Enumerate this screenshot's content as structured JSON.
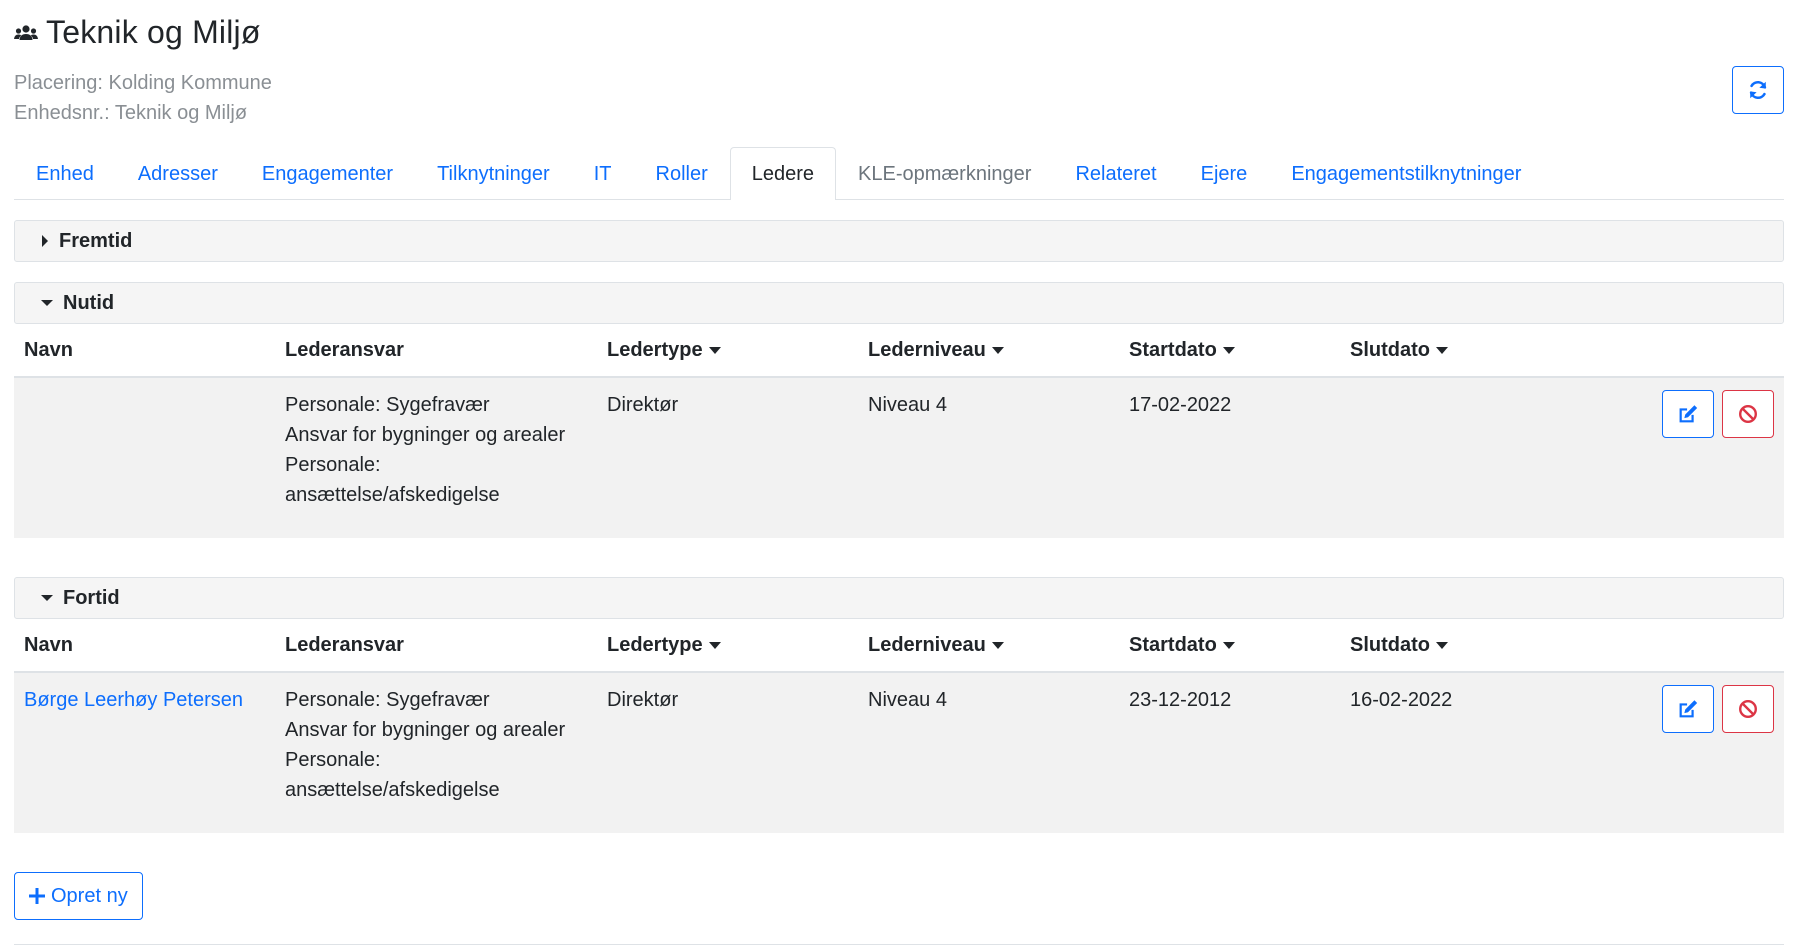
{
  "header": {
    "title": "Teknik og Miljø",
    "placering": "Placering: Kolding Kommune",
    "enhedsnr": "Enhedsnr.: Teknik og Miljø",
    "title_icon": "people-icon",
    "refresh_icon": "refresh-icon"
  },
  "tabs": [
    {
      "label": "Enhed",
      "state": "link"
    },
    {
      "label": "Adresser",
      "state": "link"
    },
    {
      "label": "Engagementer",
      "state": "link"
    },
    {
      "label": "Tilknytninger",
      "state": "link"
    },
    {
      "label": "IT",
      "state": "link"
    },
    {
      "label": "Roller",
      "state": "link"
    },
    {
      "label": "Ledere",
      "state": "active"
    },
    {
      "label": "KLE-opmærkninger",
      "state": "muted"
    },
    {
      "label": "Relateret",
      "state": "link"
    },
    {
      "label": "Ejere",
      "state": "link"
    },
    {
      "label": "Engagementstilknytninger",
      "state": "link"
    }
  ],
  "sections": {
    "fremtid": {
      "label": "Fremtid",
      "expanded": false
    },
    "nutid": {
      "label": "Nutid",
      "expanded": true
    },
    "fortid": {
      "label": "Fortid",
      "expanded": true
    }
  },
  "columns": {
    "navn": "Navn",
    "lederansvar": "Lederansvar",
    "ledertype": "Ledertype",
    "lederniveau": "Lederniveau",
    "startdato": "Startdato",
    "slutdato": "Slutdato"
  },
  "nutid_rows": [
    {
      "navn": "",
      "lederansvar": [
        "Personale: Sygefravær",
        "Ansvar for bygninger og arealer",
        "Personale:",
        "ansættelse/afskedigelse"
      ],
      "ledertype": "Direktør",
      "lederniveau": "Niveau 4",
      "startdato": "17-02-2022",
      "slutdato": ""
    }
  ],
  "fortid_rows": [
    {
      "navn": "Børge Leerhøy Petersen",
      "lederansvar": [
        "Personale: Sygefravær",
        "Ansvar for bygninger og arealer",
        "Personale:",
        "ansættelse/afskedigelse"
      ],
      "ledertype": "Direktør",
      "lederniveau": "Niveau 4",
      "startdato": "23-12-2012",
      "slutdato": "16-02-2022"
    }
  ],
  "actions": {
    "create_label": "Opret ny",
    "edit_icon": "edit-icon",
    "terminate_icon": "terminate-icon"
  },
  "colors": {
    "primary": "#0d6efd",
    "danger": "#dc3545",
    "muted_text": "#8a8f94",
    "row_bg": "#f2f2f2"
  }
}
